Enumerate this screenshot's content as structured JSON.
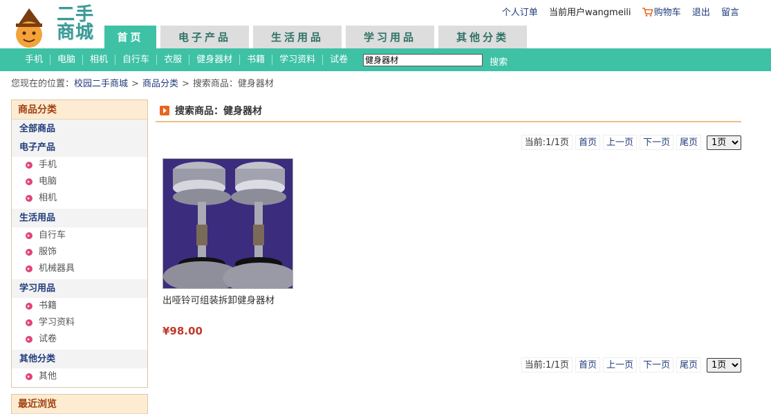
{
  "logo": {
    "text_line1": "二手",
    "text_line2": "商城"
  },
  "toplinks": {
    "orders": "个人订单",
    "current_user": "当前用户wangmeili",
    "cart": "购物车",
    "logout": "退出",
    "messages": "留言"
  },
  "main_tabs": [
    "首页",
    "电子产品",
    "生活用品",
    "学习用品",
    "其他分类"
  ],
  "sub_nav": [
    "手机",
    "电脑",
    "相机",
    "自行车",
    "衣服",
    "健身器材",
    "书籍",
    "学习资料",
    "试卷"
  ],
  "search": {
    "value": "健身器材",
    "button": "搜索"
  },
  "breadcrumb": {
    "prefix": "您现在的位置：",
    "home": "校园二手商城",
    "category": "商品分类",
    "current": "搜索商品：健身器材"
  },
  "sidebar": {
    "title": "商品分类",
    "all": "全部商品",
    "groups": [
      {
        "name": "电子产品",
        "items": [
          "手机",
          "电脑",
          "相机"
        ]
      },
      {
        "name": "生活用品",
        "items": [
          "自行车",
          "服饰",
          "机械器具"
        ]
      },
      {
        "name": "学习用品",
        "items": [
          "书籍",
          "学习资料",
          "试卷"
        ]
      },
      {
        "name": "其他分类",
        "items": [
          "其他"
        ]
      }
    ],
    "recent_title": "最近浏览"
  },
  "content": {
    "title": "搜索商品：健身器材"
  },
  "pager": {
    "status": "当前:1/1页",
    "first": "首页",
    "prev": "上一页",
    "next": "下一页",
    "last": "尾页",
    "selected": "1页"
  },
  "product": {
    "name": "出哑铃可组装拆卸健身器材",
    "price": "¥98.00"
  },
  "colors": {
    "accent": "#3ec1a5",
    "price": "#c0392b",
    "link": "#1f3a7a"
  }
}
